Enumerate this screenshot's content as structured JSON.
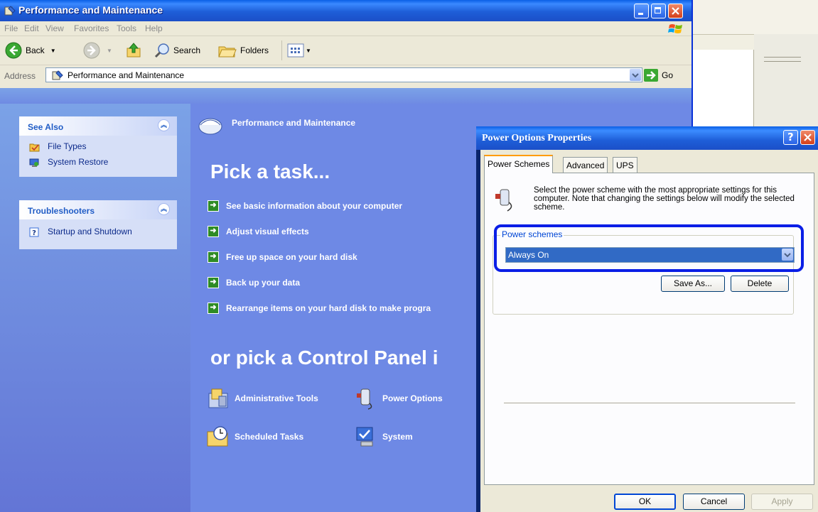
{
  "explorer": {
    "title": "Performance and Maintenance",
    "menu": [
      "File",
      "Edit",
      "View",
      "Favorites",
      "Tools",
      "Help"
    ],
    "toolbar": {
      "back": "Back",
      "search": "Search",
      "folders": "Folders"
    },
    "address": {
      "label": "Address",
      "value": "Performance and Maintenance",
      "go": "Go"
    }
  },
  "sidebar": {
    "see_also": {
      "title": "See Also",
      "items": [
        "File Types",
        "System Restore"
      ]
    },
    "troubleshooters": {
      "title": "Troubleshooters",
      "items": [
        "Startup and Shutdown"
      ]
    }
  },
  "main": {
    "section_title": "Performance and Maintenance",
    "pick_task": "Pick a task...",
    "tasks": [
      "See basic information about your computer",
      "Adjust visual effects",
      "Free up space on your hard disk",
      "Back up your data",
      "Rearrange items on your hard disk to make progra"
    ],
    "pick_cp": "or pick a Control Panel i",
    "cp_items": [
      "Administrative Tools",
      "Power Options",
      "Scheduled Tasks",
      "System"
    ]
  },
  "dialog": {
    "title": "Power Options Properties",
    "tabs": [
      "Power Schemes",
      "Advanced",
      "UPS"
    ],
    "description": "Select the power scheme with the most appropriate settings for this computer. Note that changing the settings below will modify the selected scheme.",
    "group_label": "Power schemes",
    "selected_scheme": "Always On",
    "save_as": "Save As...",
    "delete": "Delete",
    "ok": "OK",
    "cancel": "Cancel",
    "apply": "Apply"
  }
}
